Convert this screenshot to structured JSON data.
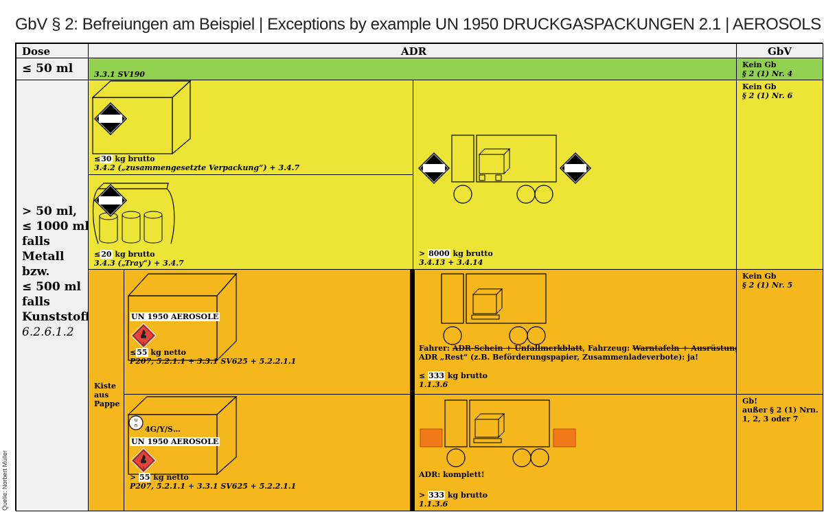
{
  "title": "GbV § 2: Befreiungen am Beispiel | Exceptions by example UN 1950 DRUCKGASPACKUNGEN 2.1 | AEROSOLS 2.1",
  "source": "Quelle: Norbert Müller",
  "header": {
    "dose": "Dose",
    "adr": "ADR",
    "gbv": "GbV"
  },
  "row1": {
    "dose": "≤ 50 ml",
    "adr_ref": "3.3.1 SV190",
    "gbv_line1": "Kein Gb",
    "gbv_line2": "§ 2 (1) Nr. 4"
  },
  "row2": {
    "dose_lines": [
      "> 50 ml,",
      "≤ 1000 ml",
      "falls",
      "Metall",
      "bzw.",
      "≤ 500 ml",
      "falls",
      "Kunststoff",
      "6.2.6.1.2"
    ],
    "box_a_weight_prefix": "≤",
    "box_a_weight_num": "30",
    "box_a_weight_unit": "kg brutto",
    "box_a_ref": "3.4.2 („zusammengesetzte Verpackung“) + 3.4.7",
    "box_b_weight_prefix": "≤",
    "box_b_weight_num": "20",
    "box_b_weight_unit": "kg brutto",
    "box_b_ref": "3.4.3 („Tray“) + 3.4.7",
    "truck_weight_prefix": ">",
    "truck_weight_num": "8000",
    "truck_weight_unit": "kg brutto",
    "truck_ref": "3.4.13 + 3.4.14",
    "gbv_line1": "Kein Gb",
    "gbv_line2": "§ 2 (1) Nr. 6"
  },
  "row3": {
    "kiste_lines": [
      "Kiste",
      "aus",
      "Pappe"
    ],
    "box_label_un": "UN",
    "box_label_num": "1950",
    "box_label_text": "AEROSOLE",
    "box_weight_prefix": "≤",
    "box_weight_num": "55",
    "box_weight_unit": "kg netto",
    "box_ref": "P207, 5.2.1.1 + 3.3.1 SV625 + 5.2.2.1.1",
    "driver_prefix": "Fahrer:",
    "driver_struck": "ADR-Schein + Unfallmerkblatt",
    "vehicle_prefix": ", Fahrzeug:",
    "vehicle_struck": "Warntafeln + Ausrüstung",
    "rest_line": "ADR „Rest“ (z.B. Beförderungspapier, Zusammenladeverbote): ja!",
    "truck_weight_prefix": "≤",
    "truck_weight_num": "333",
    "truck_weight_unit": "kg brutto",
    "truck_ref": "1.1.3.6",
    "gbv_line1": "Kein Gb",
    "gbv_line2": "§ 2 (1) Nr. 5"
  },
  "row4": {
    "un_mark_top": "u",
    "un_mark_bottom": "n",
    "pkg_code": "4G/Y/S…",
    "box_label_un": "UN",
    "box_label_num": "1950",
    "box_label_text": "AEROSOLE",
    "box_weight_prefix": ">",
    "box_weight_num": "55",
    "box_weight_unit": "kg netto",
    "box_ref": "P207, 5.2.1.1 + 3.3.1 SV625 + 5.2.2.1.1",
    "adr_full": "ADR: komplett!",
    "truck_weight_prefix": ">",
    "truck_weight_num": "333",
    "truck_weight_unit": "kg brutto",
    "truck_ref": "1.1.3.6",
    "gbv_lines": [
      "Gb!",
      "außer § 2 (1) Nrn.",
      "1, 2, 3 oder 7"
    ]
  },
  "colors": {
    "green": "#92d050",
    "yellow": "#ece535",
    "orange": "#f5b81c",
    "hazard_red": "#e8403a",
    "orange_plate": "#f07a1a"
  }
}
